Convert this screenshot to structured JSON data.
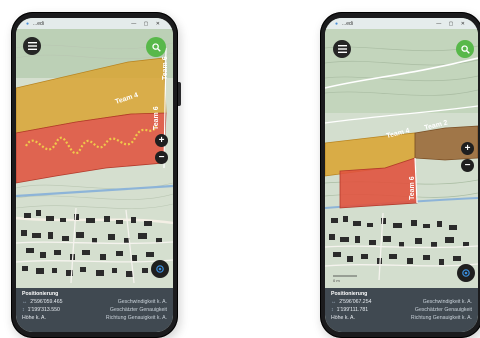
{
  "left_phone": {
    "window_title": "...edi",
    "window_controls": "— ▢ ✕",
    "teams": [
      {
        "label": "Team 4"
      },
      {
        "label": "Team 6"
      },
      {
        "label": "Team 6"
      }
    ],
    "panel": {
      "heading": "Positionierung",
      "rows": [
        {
          "left": "2'596'059.465",
          "right": "Geschwindigkeit  k. A."
        },
        {
          "left": "1'199'313.550",
          "right": "Geschätzter Genauigkeit"
        },
        {
          "left": "Höhe  k. A.",
          "right": "Richtung  Genauigkeit  k. A."
        }
      ]
    }
  },
  "right_phone": {
    "window_title": "...edi",
    "window_controls": "— ▢ ✕",
    "teams": [
      {
        "label": "Team 4"
      },
      {
        "label": "Team 2"
      },
      {
        "label": "Team 6"
      }
    ],
    "scale_label": "0 m",
    "panel": {
      "heading": "Positionierung",
      "rows": [
        {
          "left": "2'596'067.254",
          "right": "Geschwindigkeit  k. A."
        },
        {
          "left": "1'199'111.781",
          "right": "Geschätzter Genauigkeit"
        },
        {
          "left": "Höhe  k. A.",
          "right": "Richtung  Genauigkeit  k. A."
        }
      ]
    }
  },
  "colors": {
    "team_yellow": "#d9a533",
    "team_red": "#e0533f",
    "team_brown": "#9a6a3a",
    "search_green": "#58b84a",
    "phone_body": "#1b1b1d"
  },
  "icons": [
    "menu-icon",
    "search-icon",
    "zoom-in-icon",
    "zoom-out-icon",
    "locate-icon"
  ]
}
